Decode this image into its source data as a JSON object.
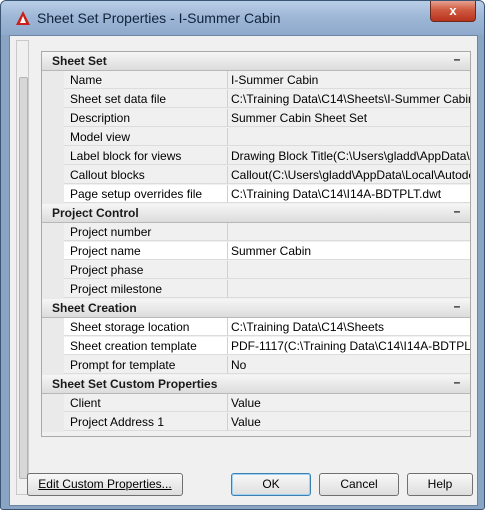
{
  "window": {
    "title": "Sheet Set Properties - I-Summer Cabin",
    "close_glyph": "x"
  },
  "sections": [
    {
      "name": "Sheet Set",
      "collapse": "–",
      "rows": [
        {
          "name": "Name",
          "value": "I-Summer Cabin",
          "highlight": false
        },
        {
          "name": "Sheet set data file",
          "value": "C:\\Training Data\\C14\\Sheets\\I-Summer Cabin...",
          "highlight": false
        },
        {
          "name": "Description",
          "value": "Summer Cabin Sheet Set",
          "highlight": false
        },
        {
          "name": "Model view",
          "value": "",
          "highlight": false
        },
        {
          "name": "Label block for views",
          "value": "Drawing Block Title(C:\\Users\\gladd\\AppData\\L...",
          "highlight": false
        },
        {
          "name": "Callout blocks",
          "value": "Callout(C:\\Users\\gladd\\AppData\\Local\\Autode...",
          "highlight": false
        },
        {
          "name": "Page setup overrides file",
          "value": "C:\\Training Data\\C14\\I14A-BDTPLT.dwt",
          "highlight": true
        }
      ]
    },
    {
      "name": "Project Control",
      "collapse": "–",
      "rows": [
        {
          "name": "Project number",
          "value": "",
          "highlight": false
        },
        {
          "name": "Project name",
          "value": "Summer Cabin",
          "highlight": true
        },
        {
          "name": "Project phase",
          "value": "",
          "highlight": false
        },
        {
          "name": "Project milestone",
          "value": "",
          "highlight": false
        }
      ]
    },
    {
      "name": "Sheet Creation",
      "collapse": "–",
      "rows": [
        {
          "name": "Sheet storage location",
          "value": "C:\\Training Data\\C14\\Sheets",
          "highlight": true
        },
        {
          "name": "Sheet creation template",
          "value": "PDF-1117(C:\\Training Data\\C14\\I14A-BDTPL...",
          "highlight": true
        },
        {
          "name": "Prompt for template",
          "value": "No",
          "highlight": false
        }
      ]
    },
    {
      "name": "Sheet Set Custom Properties",
      "collapse": "–",
      "rows": [
        {
          "name": "Client",
          "value": "Value",
          "highlight": false
        },
        {
          "name": "Project Address 1",
          "value": "Value",
          "highlight": false
        }
      ]
    }
  ],
  "buttons": {
    "edit_custom": "Edit Custom Properties...",
    "ok": "OK",
    "cancel": "Cancel",
    "help": "Help"
  }
}
